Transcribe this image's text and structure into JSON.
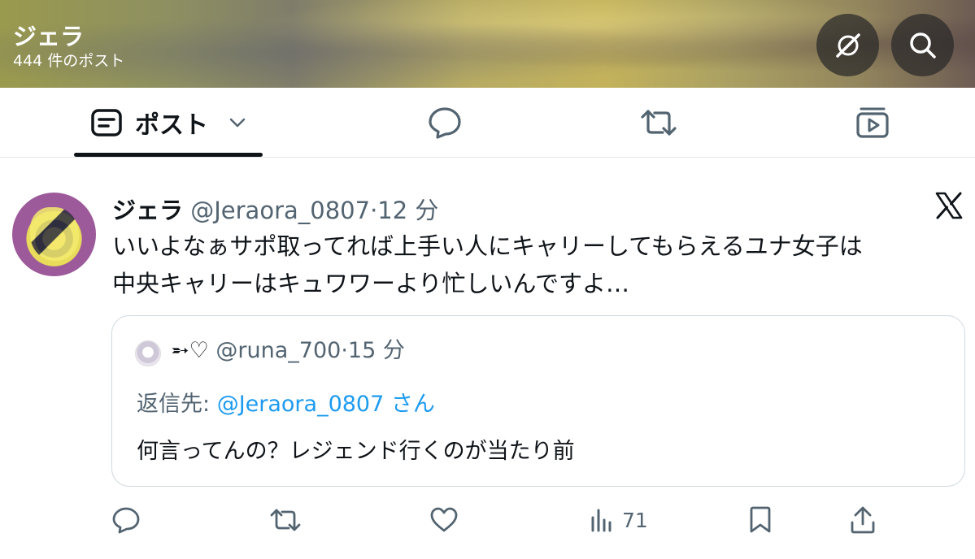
{
  "header": {
    "title": "ジェラ",
    "subtitle": "444 件のポスト",
    "grok_icon": "grok-icon",
    "search_icon": "search-icon"
  },
  "tabs": {
    "posts_label": "ポスト",
    "icons": [
      "posts-icon",
      "chevron-down-icon",
      "reply-bubble-icon",
      "repost-icon",
      "media-icon"
    ]
  },
  "post": {
    "name": "ジェラ",
    "handle": "@Jeraora_0807",
    "separator": "·",
    "time": "12 分",
    "text_line1": "いいよなぁサポ取ってれば上手い人にキャリーしてもらえるユナ女子は",
    "text_line2": "中央キャリーはキュワワーより忙しいんですよ…",
    "quote": {
      "name": "➵♡",
      "handle": "@runa_700",
      "separator": "·",
      "time": "15 分",
      "reply_prefix": "返信先: ",
      "reply_mention": "@Jeraora_0807",
      "reply_suffix": " さん",
      "text": "何言ってんの？レジェンド行くのが当たり前"
    },
    "actions": {
      "views_count": "71"
    }
  },
  "colors": {
    "text_primary": "#0f1419",
    "text_secondary": "#536471",
    "link": "#1d9bf0",
    "border": "#cfd9de"
  }
}
